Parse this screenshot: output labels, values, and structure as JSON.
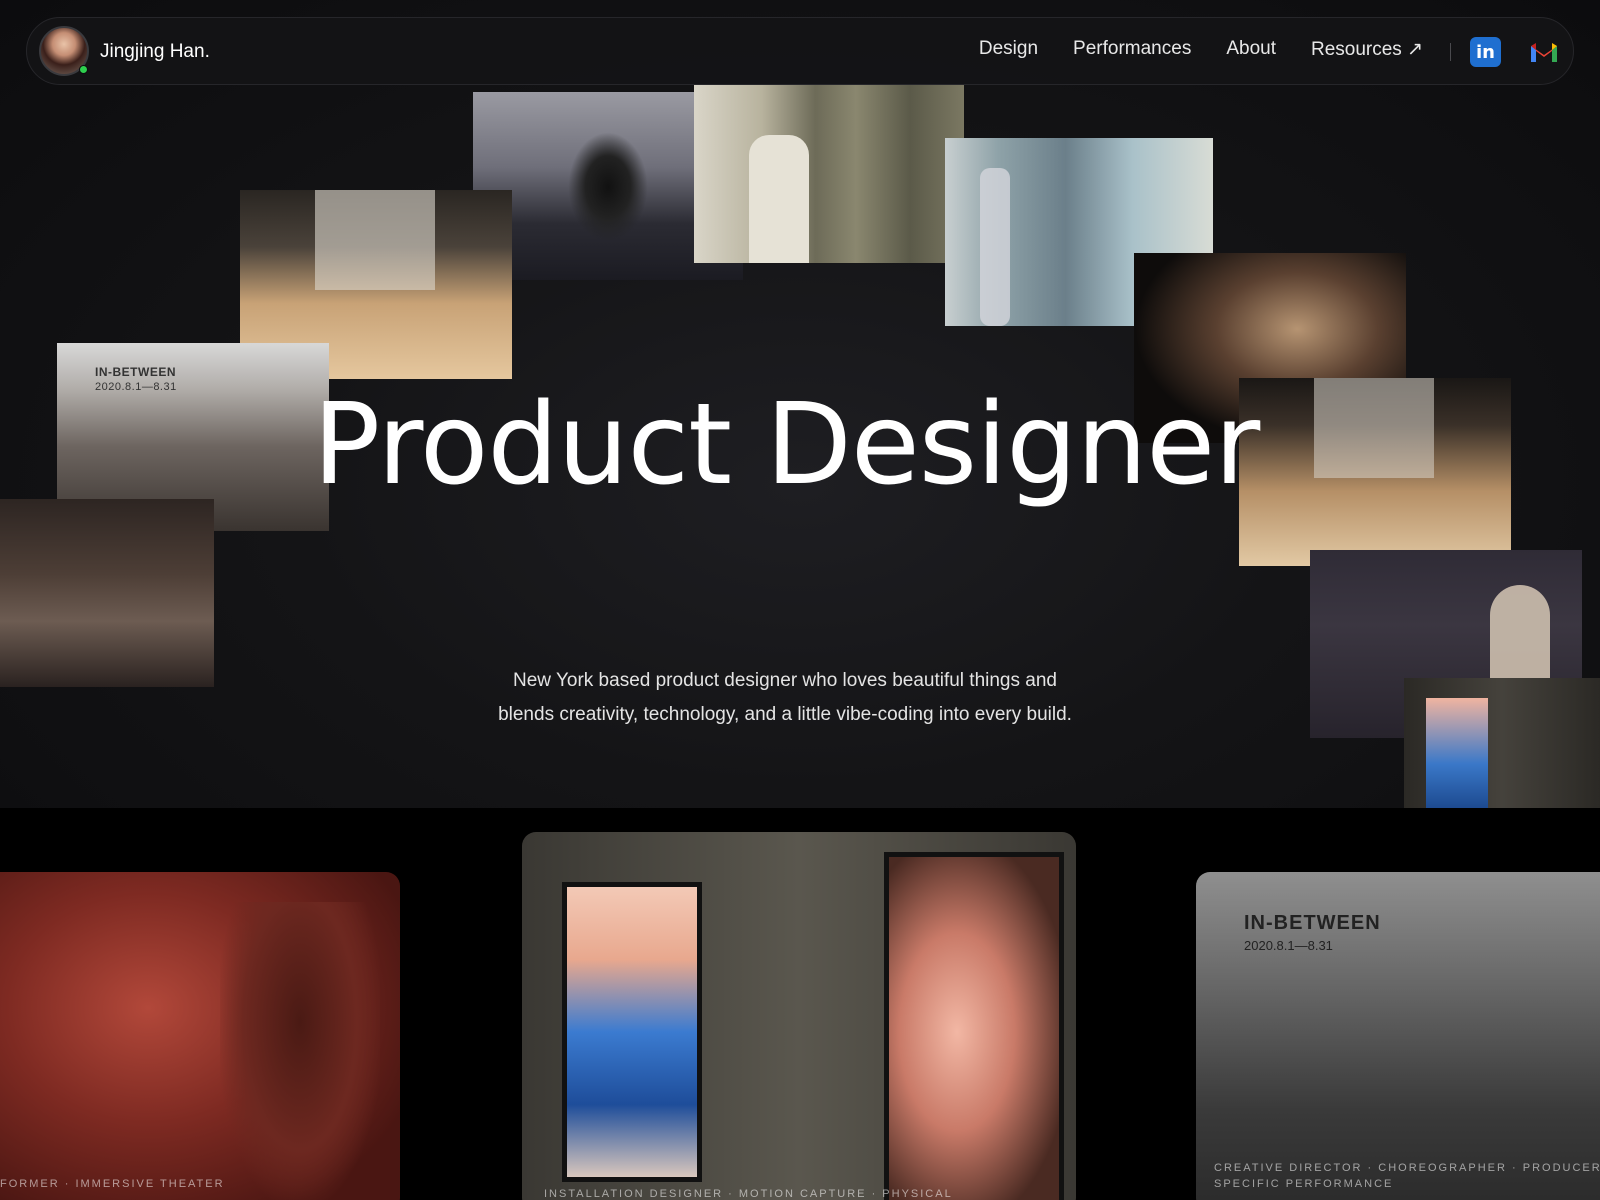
{
  "header": {
    "brand_name": "Jingjing Han.",
    "nav": [
      "Design",
      "Performances",
      "About",
      "Resources ↗"
    ],
    "linkedin_label": "in",
    "status_color": "#2ecf4e"
  },
  "hero": {
    "title": "Product Designer",
    "subtitle_line1": "New York based product designer who loves beautiful things and",
    "subtitle_line2": "blends creativity, technology, and a little vibe-coding into every build.",
    "photo_sign_label": "IN-BETWEEN",
    "photo_sign_date": "2020.8.1—8.31"
  },
  "cards": [
    {
      "caption": "FORMER · IMMERSIVE THEATER"
    },
    {
      "caption": "INSTALLATION DESIGNER · MOTION CAPTURE · PHYSICAL"
    },
    {
      "label": "IN-BETWEEN",
      "date": "2020.8.1—8.31",
      "caption_line1": "CREATIVE DIRECTOR · CHOREOGRAPHER · PRODUCER · SITE",
      "caption_line2": "SPECIFIC PERFORMANCE"
    }
  ],
  "icons": [
    "linkedin-icon",
    "gmail-icon"
  ]
}
